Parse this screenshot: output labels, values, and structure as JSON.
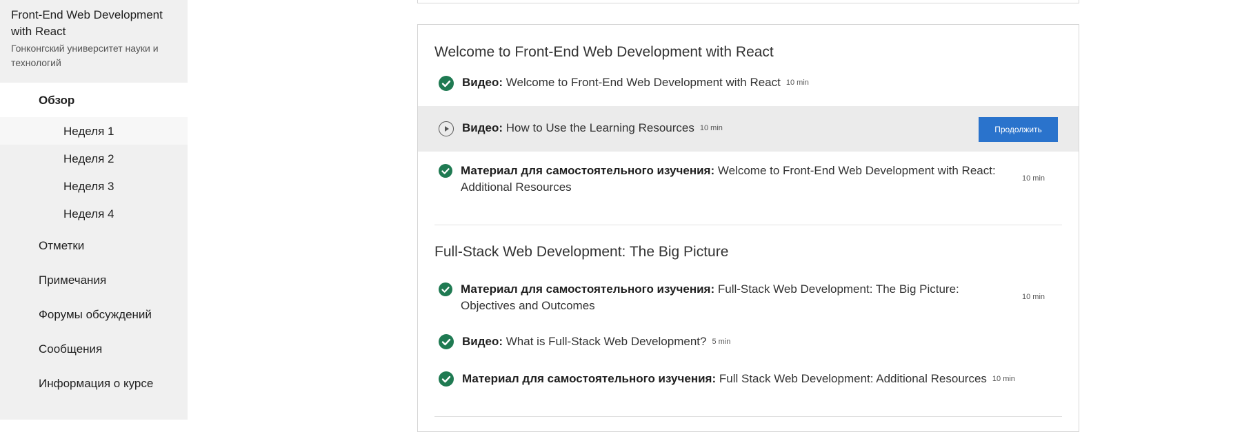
{
  "sidebar": {
    "course_title": "Front-End Web Development with React",
    "university": "Гонконгский университет науки и технологий",
    "overview_label": "Обзор",
    "weeks": [
      "Неделя 1",
      "Неделя 2",
      "Неделя 3",
      "Неделя 4"
    ],
    "main_items": [
      "Отметки",
      "Примечания",
      "Форумы обсуждений",
      "Сообщения",
      "Информация о курсе"
    ]
  },
  "lessons": [
    {
      "title": "Welcome to Front-End Web Development with React",
      "items": [
        {
          "type": "Видео:",
          "name": "Welcome to Front-End Web Development with React",
          "duration": "10 min",
          "status": "completed"
        },
        {
          "type": "Видео:",
          "name": "How to Use the Learning Resources",
          "duration": "10 min",
          "status": "in-progress",
          "action": "Продолжить"
        },
        {
          "type": "Материал для самостоятельного изучения:",
          "name": "Welcome to Front-End Web Development with React: Additional Resources",
          "duration": "10 min",
          "status": "completed"
        }
      ]
    },
    {
      "title": "Full-Stack Web Development: The Big Picture",
      "items": [
        {
          "type": "Материал для самостоятельного изучения:",
          "name": "Full-Stack Web Development: The Big Picture: Objectives and Outcomes",
          "duration": "10 min",
          "status": "completed"
        },
        {
          "type": "Видео:",
          "name": "What is Full-Stack Web Development?",
          "duration": "5 min",
          "status": "completed"
        },
        {
          "type": "Материал для самостоятельного изучения:",
          "name": "Full Stack Web Development: Additional Resources",
          "duration": "10 min",
          "status": "completed"
        }
      ]
    }
  ],
  "colors": {
    "accent": "#2a73cc",
    "completed": "#1f7a52",
    "sidebar_bg": "#f0f0f0"
  }
}
